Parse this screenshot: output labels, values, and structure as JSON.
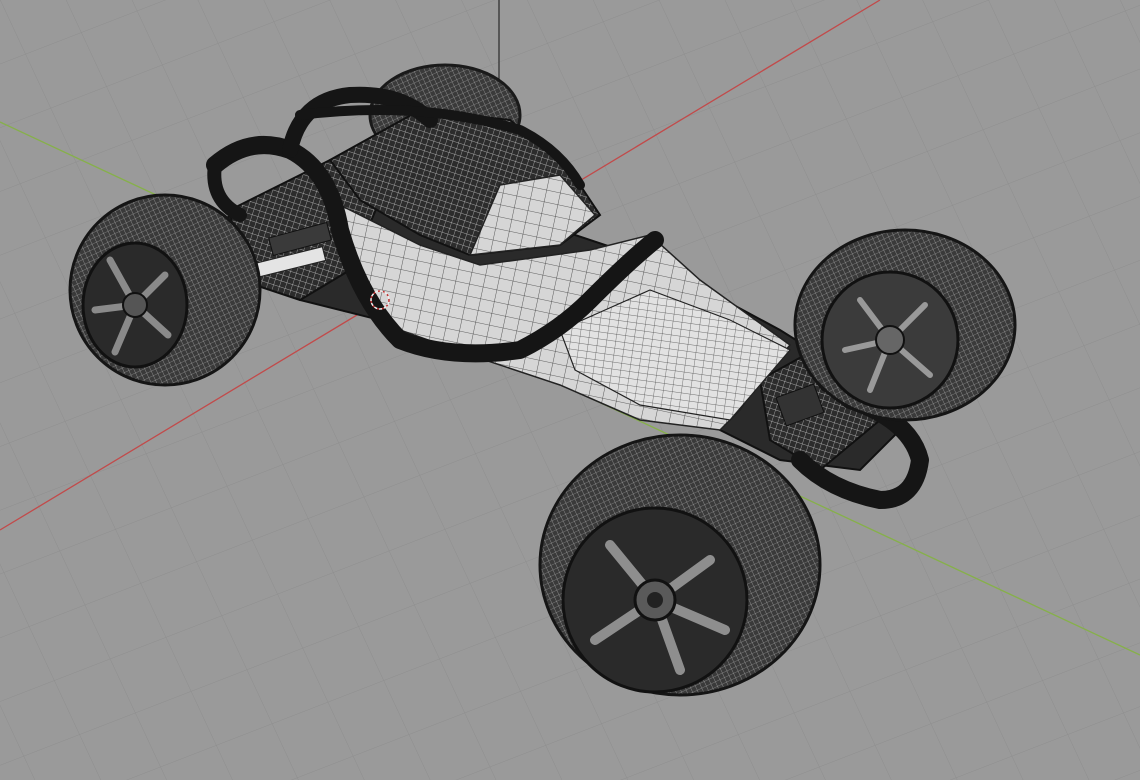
{
  "viewport": {
    "background_color": "#9a9a9a",
    "grid_line_color": "#8d8d8d",
    "x_axis_color": "#c24a4a",
    "y_axis_color": "#86b04a",
    "z_axis_color": "#2a2a2a",
    "wire_dark": "#1c1c1c",
    "body_light": "#d8d8d8",
    "cursor_color": "#c03030",
    "model_icon": "wireframe-buggy-model-icon",
    "cursor_icon": "3d-cursor-icon"
  }
}
